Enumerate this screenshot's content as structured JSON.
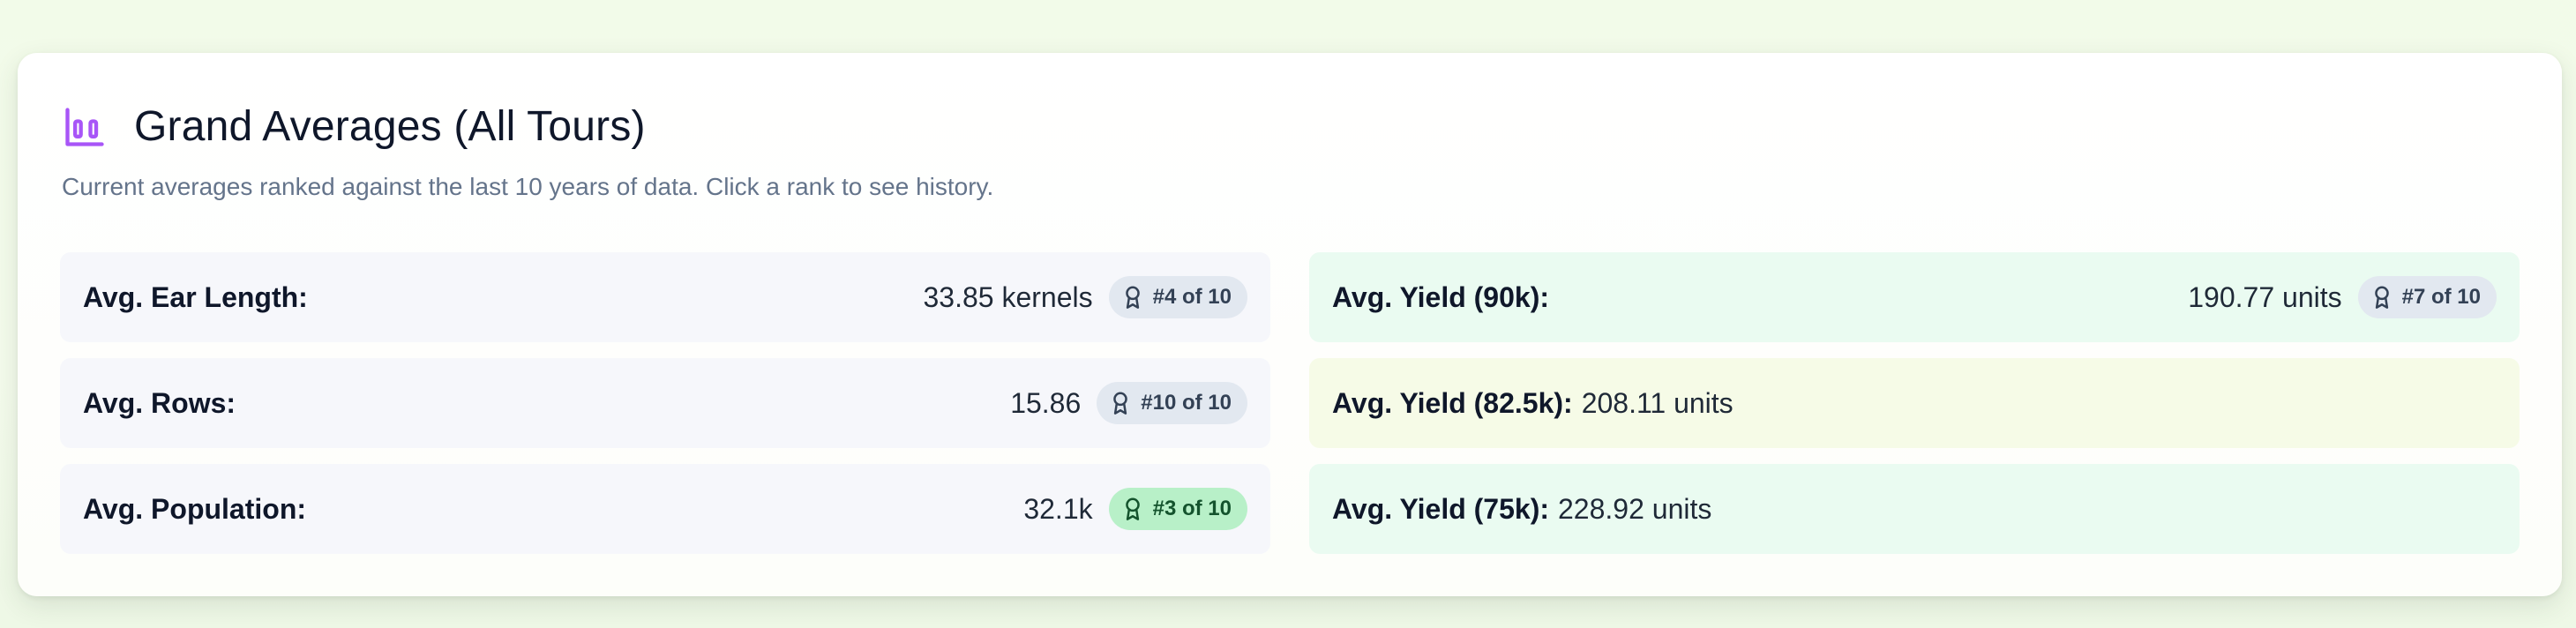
{
  "card": {
    "title": "Grand Averages (All Tours)",
    "subtitle": "Current averages ranked against the last 10 years of data. Click a rank to see history.",
    "icon": "bar-chart-icon",
    "accent": "#a855f7"
  },
  "left": [
    {
      "label": "Avg. Ear Length:",
      "value": "33.85 kernels",
      "rank": "#4 of 10"
    },
    {
      "label": "Avg. Rows:",
      "value": "15.86",
      "rank": "#10 of 10"
    },
    {
      "label": "Avg. Population:",
      "value": "32.1k",
      "rank": "#3 of 10",
      "rank_color": "#b8f0c8"
    }
  ],
  "right": [
    {
      "label": "Avg. Yield (90k):",
      "value": "190.77 units",
      "rank": "#7 of 10"
    },
    {
      "label": "Avg. Yield (82.5k):",
      "value": "208.11 units"
    },
    {
      "label": "Avg. Yield (75k):",
      "value": "228.92 units"
    }
  ]
}
